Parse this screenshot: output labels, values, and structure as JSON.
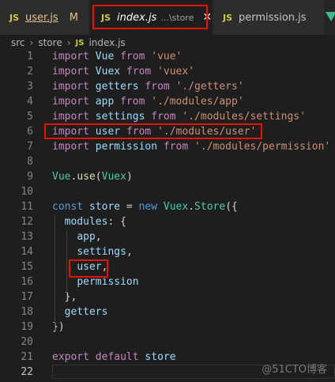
{
  "tabs": {
    "user": {
      "badge": "JS",
      "label": "user.js",
      "status": "M"
    },
    "index": {
      "badge": "JS",
      "label": "index.js",
      "path": "...\\store",
      "close": "✕"
    },
    "permission": {
      "badge": "JS",
      "label": "permission.js"
    }
  },
  "breadcrumb": {
    "parts": [
      "src",
      "store",
      "index.js"
    ],
    "sep": "›",
    "badge": "JS"
  },
  "code": {
    "lines": [
      {
        "n": "1",
        "t": [
          [
            "kw-import",
            "import"
          ],
          [
            "punc",
            " "
          ],
          [
            "id",
            "Vue"
          ],
          [
            "punc",
            " "
          ],
          [
            "kw-import",
            "from"
          ],
          [
            "punc",
            " "
          ],
          [
            "str",
            "'vue'"
          ]
        ]
      },
      {
        "n": "2",
        "t": [
          [
            "kw-import",
            "import"
          ],
          [
            "punc",
            " "
          ],
          [
            "id",
            "Vuex"
          ],
          [
            "punc",
            " "
          ],
          [
            "kw-import",
            "from"
          ],
          [
            "punc",
            " "
          ],
          [
            "str",
            "'vuex'"
          ]
        ]
      },
      {
        "n": "3",
        "t": [
          [
            "kw-import",
            "import"
          ],
          [
            "punc",
            " "
          ],
          [
            "id",
            "getters"
          ],
          [
            "punc",
            " "
          ],
          [
            "kw-import",
            "from"
          ],
          [
            "punc",
            " "
          ],
          [
            "str",
            "'./getters'"
          ]
        ]
      },
      {
        "n": "4",
        "t": [
          [
            "kw-import",
            "import"
          ],
          [
            "punc",
            " "
          ],
          [
            "id",
            "app"
          ],
          [
            "punc",
            " "
          ],
          [
            "kw-import",
            "from"
          ],
          [
            "punc",
            " "
          ],
          [
            "str",
            "'./modules/app'"
          ]
        ]
      },
      {
        "n": "5",
        "t": [
          [
            "kw-import",
            "import"
          ],
          [
            "punc",
            " "
          ],
          [
            "id",
            "settings"
          ],
          [
            "punc",
            " "
          ],
          [
            "kw-import",
            "from"
          ],
          [
            "punc",
            " "
          ],
          [
            "str",
            "'./modules/settings'"
          ]
        ]
      },
      {
        "n": "6",
        "t": [
          [
            "kw-import",
            "import"
          ],
          [
            "punc",
            " "
          ],
          [
            "id",
            "user"
          ],
          [
            "punc",
            " "
          ],
          [
            "kw-import",
            "from"
          ],
          [
            "punc",
            " "
          ],
          [
            "str",
            "'./modules/user'"
          ]
        ]
      },
      {
        "n": "7",
        "t": [
          [
            "kw-import",
            "import"
          ],
          [
            "punc",
            " "
          ],
          [
            "id",
            "permission"
          ],
          [
            "punc",
            " "
          ],
          [
            "kw-import",
            "from"
          ],
          [
            "punc",
            " "
          ],
          [
            "str",
            "'./modules/permission'"
          ]
        ]
      },
      {
        "n": "8",
        "t": []
      },
      {
        "n": "9",
        "t": [
          [
            "cls",
            "Vue"
          ],
          [
            "punc",
            "."
          ],
          [
            "fn",
            "use"
          ],
          [
            "punc",
            "("
          ],
          [
            "cls",
            "Vuex"
          ],
          [
            "punc",
            ")"
          ]
        ]
      },
      {
        "n": "10",
        "t": []
      },
      {
        "n": "11",
        "t": [
          [
            "kw-blue",
            "const"
          ],
          [
            "punc",
            " "
          ],
          [
            "id",
            "store"
          ],
          [
            "punc",
            " = "
          ],
          [
            "kw-blue",
            "new"
          ],
          [
            "punc",
            " "
          ],
          [
            "cls",
            "Vuex"
          ],
          [
            "punc",
            "."
          ],
          [
            "cls",
            "Store"
          ],
          [
            "punc",
            "({"
          ]
        ]
      },
      {
        "n": "12",
        "t": [
          [
            "punc",
            "  "
          ],
          [
            "id",
            "modules"
          ],
          [
            "punc",
            ": {"
          ]
        ]
      },
      {
        "n": "13",
        "t": [
          [
            "punc",
            "    "
          ],
          [
            "id",
            "app"
          ],
          [
            "punc",
            ","
          ]
        ]
      },
      {
        "n": "14",
        "t": [
          [
            "punc",
            "    "
          ],
          [
            "id",
            "settings"
          ],
          [
            "punc",
            ","
          ]
        ]
      },
      {
        "n": "15",
        "t": [
          [
            "punc",
            "    "
          ],
          [
            "id",
            "user"
          ],
          [
            "punc",
            ","
          ]
        ]
      },
      {
        "n": "16",
        "t": [
          [
            "punc",
            "    "
          ],
          [
            "id",
            "permission"
          ]
        ]
      },
      {
        "n": "17",
        "t": [
          [
            "punc",
            "  },"
          ]
        ]
      },
      {
        "n": "18",
        "t": [
          [
            "punc",
            "  "
          ],
          [
            "id",
            "getters"
          ]
        ]
      },
      {
        "n": "19",
        "t": [
          [
            "punc",
            "})"
          ]
        ]
      },
      {
        "n": "20",
        "t": []
      },
      {
        "n": "21",
        "t": [
          [
            "kw-import",
            "export"
          ],
          [
            "punc",
            " "
          ],
          [
            "kw-import",
            "default"
          ],
          [
            "punc",
            " "
          ],
          [
            "id",
            "store"
          ]
        ]
      },
      {
        "n": "22",
        "t": []
      }
    ],
    "active_line": "22"
  },
  "watermark": "@51CTO博客"
}
